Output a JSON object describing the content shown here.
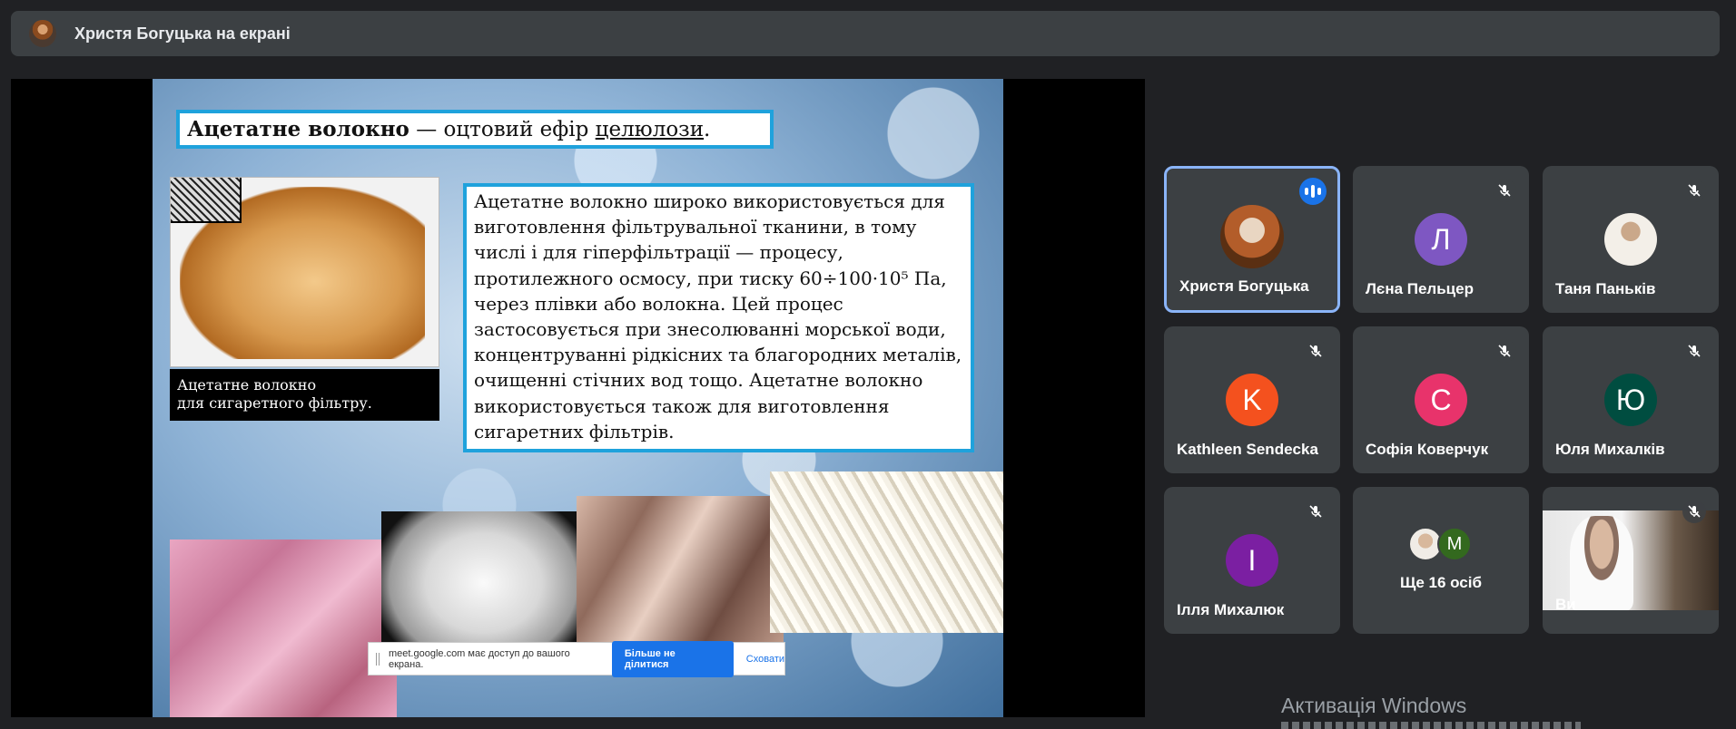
{
  "top_bar": {
    "presenter_title": "Христя Богуцька на екрані"
  },
  "slide": {
    "title_bold": "Ацетатне волокно",
    "title_rest": " — оцтовий ефір ",
    "title_link": "целюлози",
    "title_end": ".",
    "photo_caption_line1": "Ацетатне волокно",
    "photo_caption_line2": "для сигаретного фільтру.",
    "body_text": "Ацетатне волокно широко використовується для виготовлення фільтрувальної тканини, в тому числі і для гіперфільтрації — процесу, протилежного осмосу, при тиску 60÷100·10⁵ Па, через плівки або волокна. Цей процес застосовується при знесолюванні морської води, концентруванні рідкісних та благородних металів, очищенні стічних вод тощо. Ацетатне волокно використовується також для виготовлення сигаретних фільтрів."
  },
  "share_notice": {
    "text": "meet.google.com має доступ до вашого екрана.",
    "stop_label": "Більше не ділитися",
    "hide_label": "Сховати"
  },
  "participants": [
    {
      "name": "Христя Богуцька",
      "initial": "",
      "color": "#8a4a1e",
      "state": "speaking"
    },
    {
      "name": "Лєна Пельцер",
      "initial": "Л",
      "color": "#7e57c2",
      "state": "muted"
    },
    {
      "name": "Таня Паньків",
      "initial": "",
      "color": "#c7b8a8",
      "state": "muted"
    },
    {
      "name": "Kathleen Sendecka",
      "initial": "K",
      "color": "#f4511e",
      "state": "muted"
    },
    {
      "name": "Софія Коверчук",
      "initial": "C",
      "color": "#e8336b",
      "state": "muted"
    },
    {
      "name": "Юля Михалків",
      "initial": "Ю",
      "color": "#004d40",
      "state": "muted"
    },
    {
      "name": "Ілля Михалюк",
      "initial": "I",
      "color": "#7b1fa2",
      "state": "muted"
    }
  ],
  "more_tile": {
    "label": "Ще 16 осіб",
    "avatar_initial": "M",
    "avatar_color": "#33691e"
  },
  "self_tile": {
    "name": "Ви"
  },
  "watermark": "Активація Windows"
}
